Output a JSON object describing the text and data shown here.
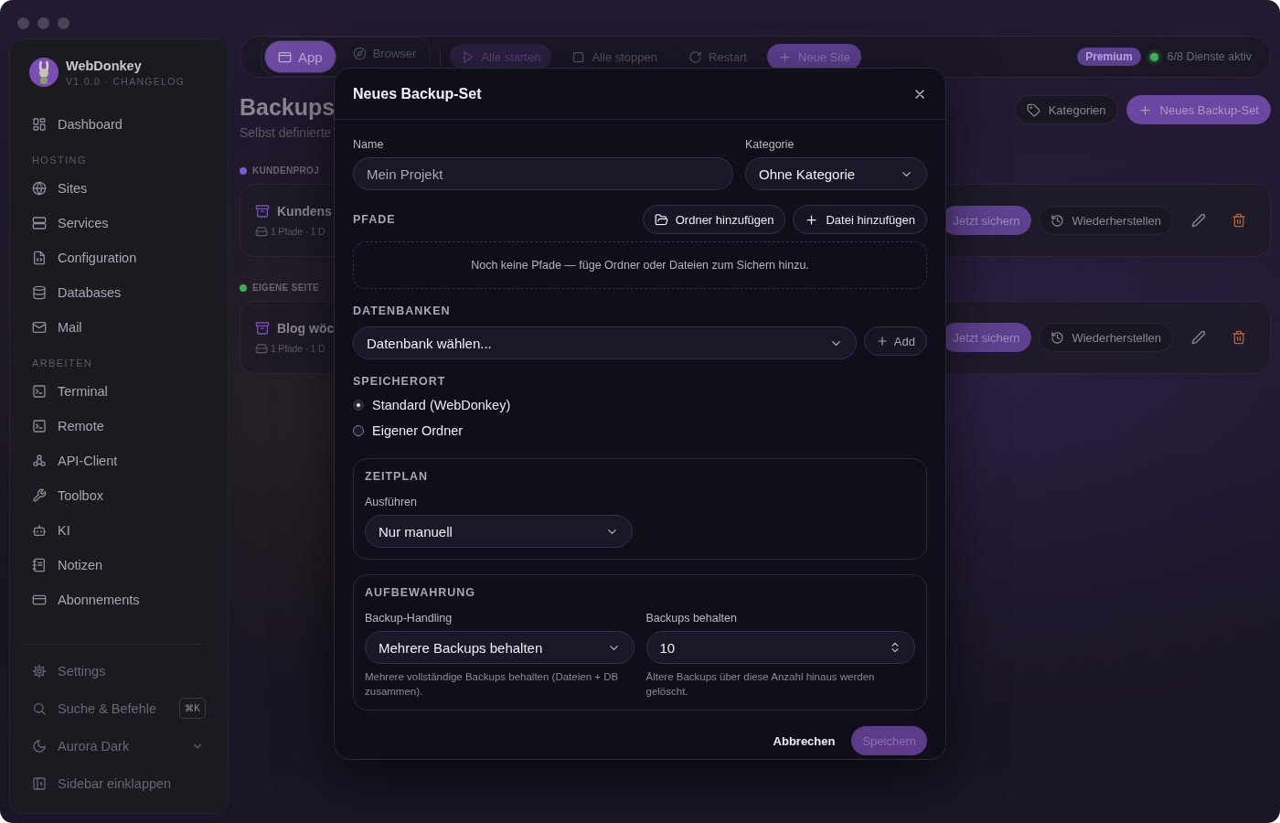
{
  "sidebar": {
    "app_name": "WebDonkey",
    "version": "V1.0.0 · CHANGELOG",
    "nav": [
      {
        "label": "Dashboard"
      }
    ],
    "sections": [
      {
        "heading": "HOSTING",
        "items": [
          {
            "label": "Sites"
          },
          {
            "label": "Services"
          },
          {
            "label": "Configuration"
          },
          {
            "label": "Databases"
          },
          {
            "label": "Mail"
          }
        ]
      },
      {
        "heading": "ARBEITEN",
        "items": [
          {
            "label": "Terminal"
          },
          {
            "label": "Remote"
          },
          {
            "label": "API-Client"
          },
          {
            "label": "Toolbox"
          },
          {
            "label": "KI"
          },
          {
            "label": "Notizen"
          },
          {
            "label": "Abonnements"
          }
        ]
      }
    ],
    "footer": [
      {
        "kind": "link",
        "label": "Settings"
      },
      {
        "kind": "shortcut",
        "label": "Suche & Befehle",
        "shortcut": "⌘K"
      },
      {
        "kind": "dropdown",
        "label": "Aurora Dark"
      },
      {
        "kind": "link",
        "label": "Sidebar einklappen"
      }
    ]
  },
  "toolbar": {
    "views": [
      {
        "label": "App",
        "selected": true
      },
      {
        "label": "Browser",
        "selected": false
      }
    ],
    "actions": [
      {
        "label": "Alle starten",
        "kind": "soft"
      },
      {
        "label": "Alle stoppen",
        "kind": "plain"
      },
      {
        "label": "Restart",
        "kind": "plain"
      },
      {
        "label": "Neue Site",
        "kind": "primary"
      }
    ],
    "plan": "Premium",
    "status": "6/8 Dienste aktiv"
  },
  "page": {
    "title": "Backups",
    "subtitle": "Selbst definierte",
    "buttons": [
      {
        "label": "Kategorien",
        "kind": "plain"
      },
      {
        "label": "Neues Backup-Set",
        "kind": "primary"
      }
    ],
    "groups": [
      {
        "label": "KUNDENPROJ",
        "color": "#7b58d8",
        "sets": [
          {
            "name": "Kundens",
            "meta": "1 Pfade · 1 D",
            "backup": "Jetzt sichern",
            "restore": "Wiederherstellen"
          }
        ]
      },
      {
        "label": "EIGENE SEITE",
        "color": "#3fae5a",
        "sets": [
          {
            "name": "Blog wöc",
            "meta": "1 Pfade · 1 D",
            "backup": "Jetzt sichern",
            "restore": "Wiederherstellen"
          }
        ]
      }
    ]
  },
  "dialog": {
    "title": "Neues Backup-Set",
    "name": {
      "label": "Name",
      "placeholder": "Mein Projekt"
    },
    "category": {
      "label": "Kategorie",
      "value": "Ohne Kategorie"
    },
    "paths": {
      "heading": "PFADE",
      "add_folder": "Ordner hinzufügen",
      "add_file": "Datei hinzufügen",
      "empty": "Noch keine Pfade — füge Ordner oder Dateien zum Sichern hinzu."
    },
    "databases": {
      "heading": "DATENBANKEN",
      "select": "Datenbank wählen...",
      "add": "Add"
    },
    "location": {
      "heading": "SPEICHERORT",
      "options": [
        {
          "label": "Standard (WebDonkey)",
          "selected": true
        },
        {
          "label": "Eigener Ordner",
          "selected": false
        }
      ]
    },
    "schedule": {
      "heading": "ZEITPLAN",
      "label": "Ausführen",
      "value": "Nur manuell"
    },
    "retention": {
      "heading": "AUFBEWAHRUNG",
      "handling_label": "Backup-Handling",
      "handling_value": "Mehrere Backups behalten",
      "handling_hint": "Mehrere vollständige Backups behalten (Dateien + DB zusammen).",
      "keep_label": "Backups behalten",
      "keep_value": "10",
      "keep_hint": "Ältere Backups über diese Anzahl hinaus werden gelöscht."
    },
    "cancel": "Abbrechen",
    "save": {
      "label": "Speichern",
      "disabled": true
    }
  }
}
